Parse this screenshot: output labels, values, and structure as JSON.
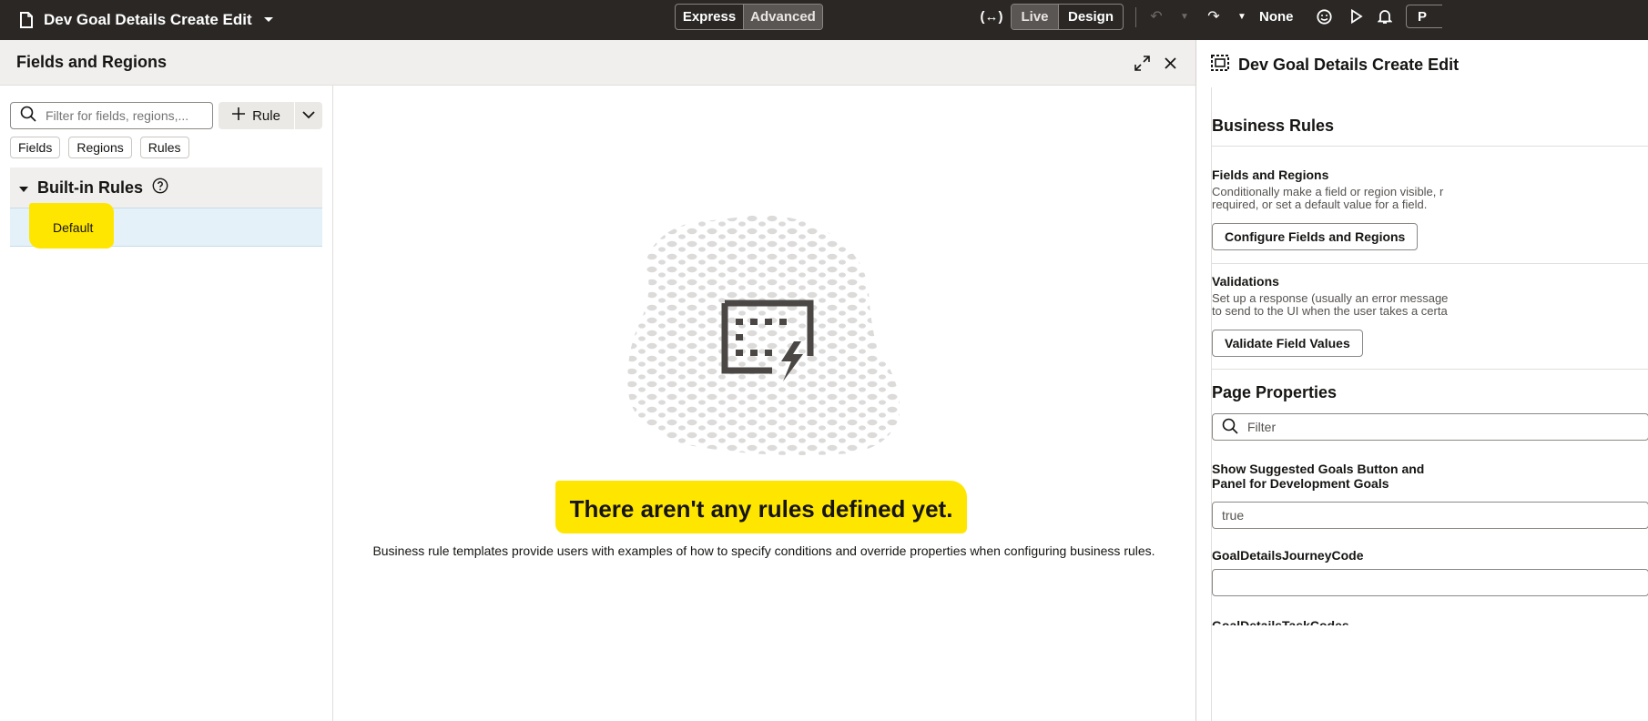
{
  "topbar": {
    "page_title": "Dev Goal Details Create Edit",
    "mode_express": "Express",
    "mode_advanced": "Advanced",
    "view_live": "Live",
    "view_design": "Design",
    "sandbox": "None",
    "truncated_button": "P"
  },
  "drawer": {
    "title": "Fields and Regions",
    "filter_placeholder": "Filter for fields, regions,...",
    "rule_button": "Rule",
    "chips": [
      "Fields",
      "Regions",
      "Rules"
    ],
    "group_title": "Built-in Rules",
    "group_item": "Default",
    "empty_title": "There aren't any rules defined yet.",
    "empty_desc": "Business rule templates provide users with examples of how to specify conditions and override properties when configuring business rules."
  },
  "panel": {
    "title": "Dev Goal Details Create Edit",
    "business_rules": "Business Rules",
    "fields_regions_title": "Fields and Regions",
    "fields_regions_desc_1": "Conditionally make a field or region visible, r",
    "fields_regions_desc_2": "required, or set a default value for a field.",
    "configure_button": "Configure Fields and Regions",
    "validations_title": "Validations",
    "validations_desc_1": "Set up a response (usually an error message",
    "validations_desc_2": "to send to the UI when the user takes a certa",
    "validate_button": "Validate Field Values",
    "page_properties": "Page Properties",
    "filter_placeholder": "Filter",
    "prop1_label_1": "Show Suggested Goals Button and",
    "prop1_label_2": "Panel for Development Goals",
    "prop1_value": "true",
    "prop2_label": "GoalDetailsJourneyCode",
    "prop2_value": "",
    "prop3_label": "GoalDetailsTaskCodes"
  },
  "colors": {
    "topbar_bg": "#2a2725",
    "highlight": "#ffe600",
    "selected_row": "#e4f1f8"
  }
}
